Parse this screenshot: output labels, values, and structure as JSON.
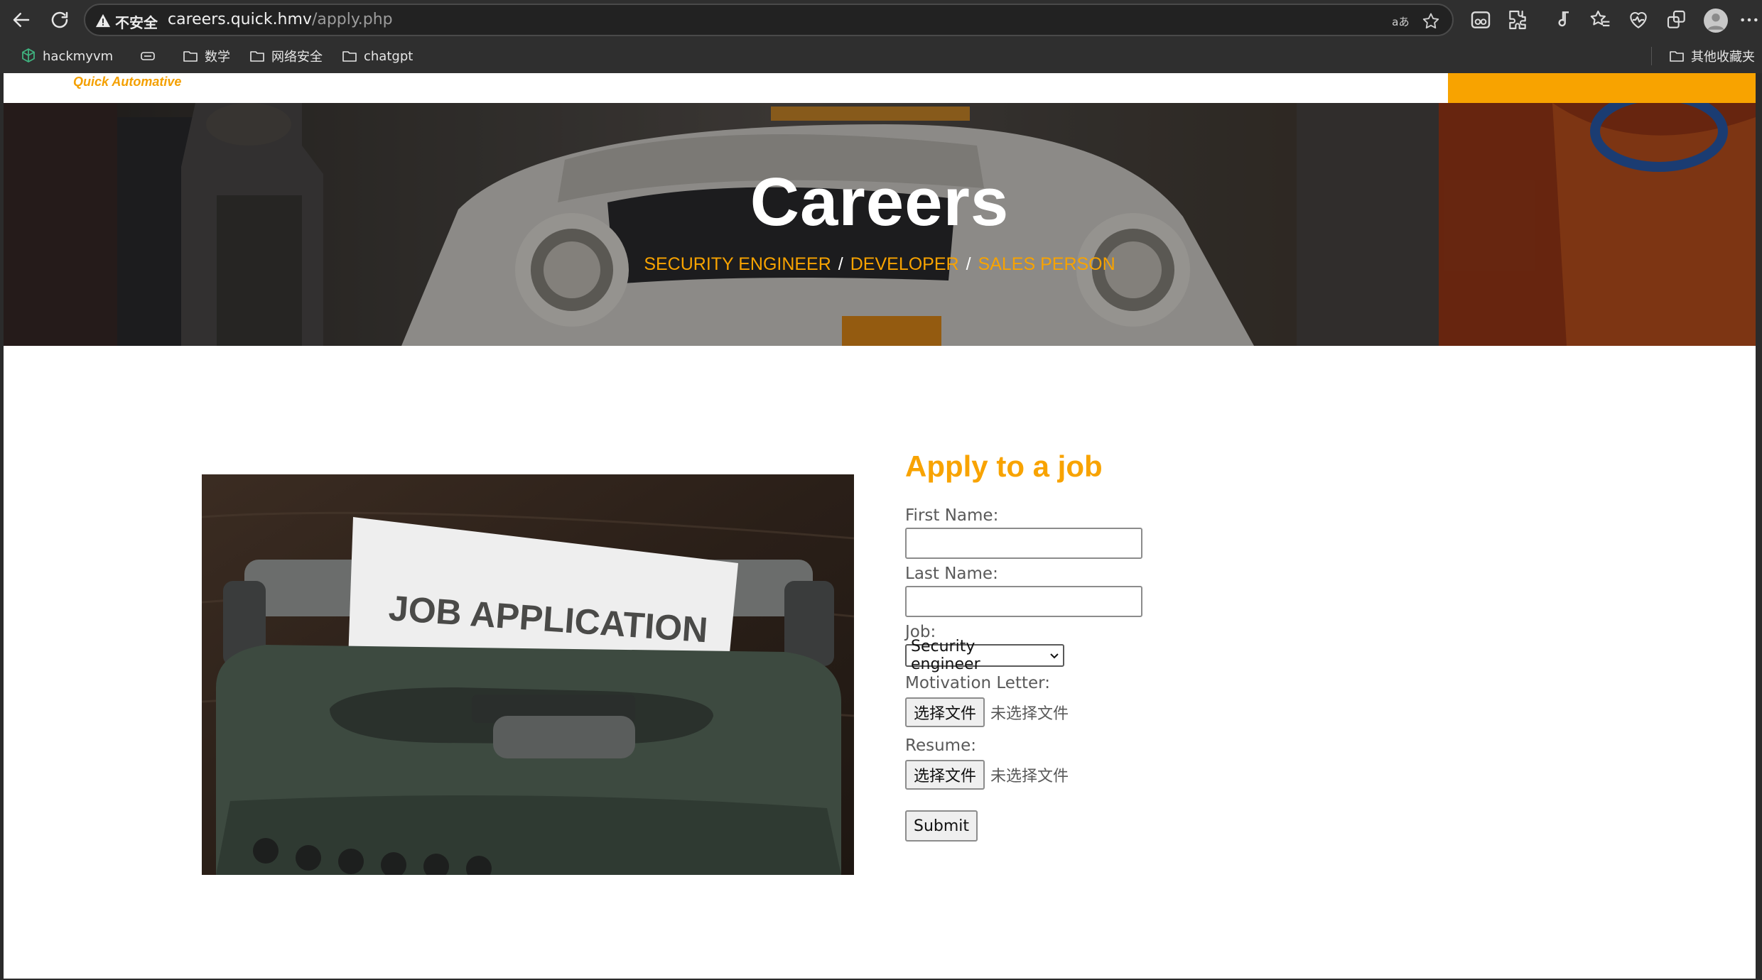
{
  "browser": {
    "security_label": "不安全",
    "url_host": "careers.quick.hmv",
    "url_path": "/apply.php",
    "bookmarks": [
      "hackmyvm",
      "数学",
      "网络安全",
      "chatgpt"
    ],
    "other_bookmarks": "其他收藏夹"
  },
  "site": {
    "logo_text": "Quick Automative",
    "accent_color": "#f8a300"
  },
  "hero": {
    "title": "Careers",
    "crumbs": [
      "SECURITY ENGINEER",
      "DEVELOPER",
      "SALES PERSON"
    ],
    "separator": "/"
  },
  "image": {
    "paper_text": "JOB APPLICATION"
  },
  "form": {
    "heading": "Apply to a job",
    "first_name_label": "First Name:",
    "first_name_value": "",
    "last_name_label": "Last Name:",
    "last_name_value": "",
    "job_label": "Job:",
    "job_selected": "Security engineer",
    "motivation_label": "Motivation Letter:",
    "resume_label": "Resume:",
    "file_button": "选择文件",
    "file_none": "未选择文件",
    "submit_label": "Submit"
  }
}
